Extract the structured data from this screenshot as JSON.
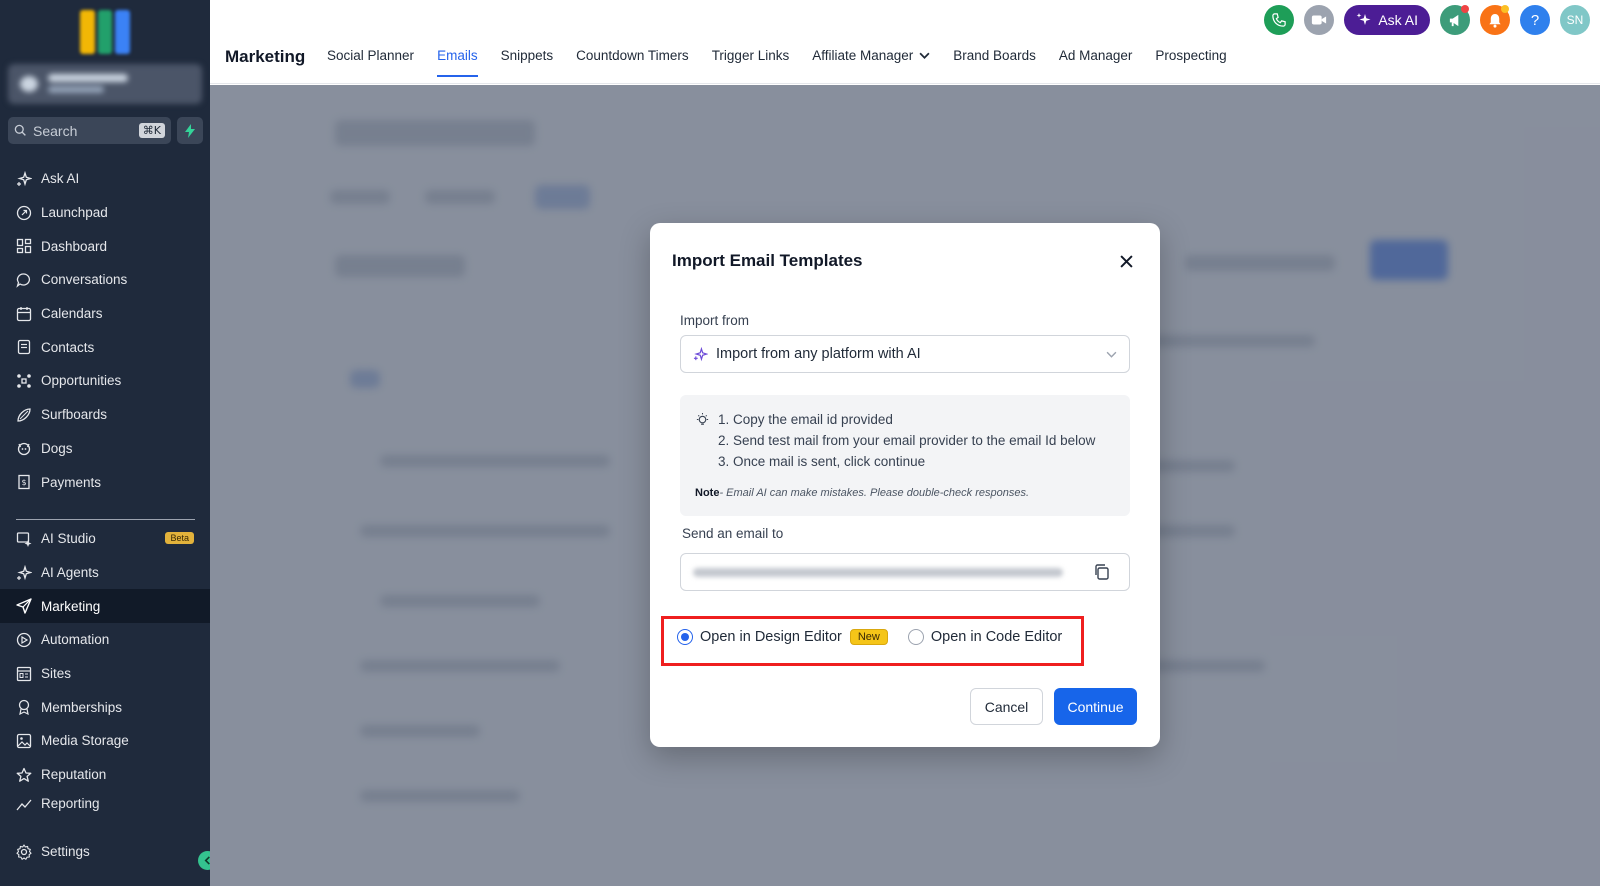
{
  "sidebar": {
    "logo_colors": [
      "#f2b705",
      "#22a06b",
      "#3b82f6"
    ],
    "search": {
      "placeholder": "Search",
      "shortcut": "⌘K"
    },
    "items": [
      {
        "label": "Ask AI",
        "icon": "sparkle-icon"
      },
      {
        "label": "Launchpad",
        "icon": "rocket-icon"
      },
      {
        "label": "Dashboard",
        "icon": "grid-icon"
      },
      {
        "label": "Conversations",
        "icon": "chat-bubble-icon"
      },
      {
        "label": "Calendars",
        "icon": "calendar-icon"
      },
      {
        "label": "Contacts",
        "icon": "contact-book-icon"
      },
      {
        "label": "Opportunities",
        "icon": "network-icon"
      },
      {
        "label": "Surfboards",
        "icon": "surfboard-icon"
      },
      {
        "label": "Dogs",
        "icon": "paw-icon"
      },
      {
        "label": "Payments",
        "icon": "receipt-icon"
      }
    ],
    "items2": [
      {
        "label": "AI Studio",
        "icon": "ai-studio-icon",
        "badge": "Beta"
      },
      {
        "label": "AI Agents",
        "icon": "sparkle-icon"
      },
      {
        "label": "Marketing",
        "icon": "paper-plane-icon",
        "active": true
      },
      {
        "label": "Automation",
        "icon": "automation-icon"
      },
      {
        "label": "Sites",
        "icon": "sites-icon"
      },
      {
        "label": "Memberships",
        "icon": "award-icon"
      },
      {
        "label": "Media Storage",
        "icon": "image-icon"
      },
      {
        "label": "Reputation",
        "icon": "star-icon"
      },
      {
        "label": "Reporting",
        "icon": "chart-line-icon"
      }
    ],
    "settings": {
      "label": "Settings",
      "icon": "gear-icon"
    }
  },
  "header": {
    "title": "Marketing",
    "tabs": [
      {
        "label": "Social Planner"
      },
      {
        "label": "Emails",
        "active": true
      },
      {
        "label": "Snippets"
      },
      {
        "label": "Countdown Timers"
      },
      {
        "label": "Trigger Links"
      },
      {
        "label": "Affiliate Manager",
        "dropdown": true
      },
      {
        "label": "Brand Boards"
      },
      {
        "label": "Ad Manager"
      },
      {
        "label": "Prospecting"
      }
    ],
    "ask_ai_label": "Ask AI",
    "help_label": "?",
    "avatar_initials": "SN",
    "colors": {
      "phone": "#1e9e58",
      "video": "#9ca3af",
      "megaphone": "#3d9c7a",
      "bell": "#f97316",
      "help": "#2f80ed"
    }
  },
  "modal": {
    "title": "Import Email Templates",
    "import_from_label": "Import from",
    "import_from_value": "Import from any platform with AI",
    "steps": [
      "1. Copy the email id provided",
      "2. Send test mail from your email provider to the email Id below",
      "3. Once mail is sent, click continue"
    ],
    "note_label": "Note",
    "note_text": "- Email AI can make mistakes. Please double-check responses.",
    "send_label": "Send an email to",
    "options": {
      "design": {
        "label": "Open in Design Editor",
        "badge": "New",
        "selected": true
      },
      "code": {
        "label": "Open in Code Editor",
        "selected": false
      }
    },
    "cancel_label": "Cancel",
    "continue_label": "Continue"
  }
}
